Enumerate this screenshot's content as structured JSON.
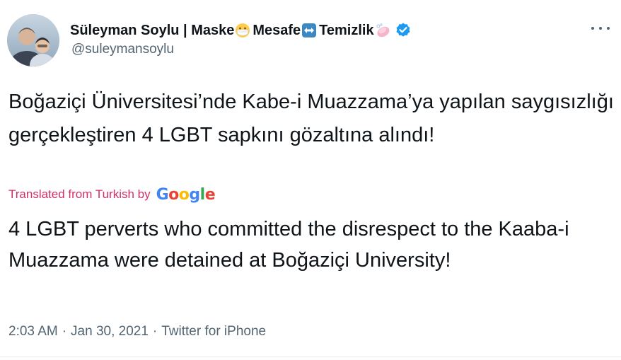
{
  "author": {
    "name_part1": "Süleyman Soylu | Maske",
    "name_part2": "Mesafe",
    "name_part3": "Temizlik",
    "handle": "@suleymansoylu"
  },
  "tweet": {
    "original_text": "Boğaziçi Üniversitesi’nde Kabe-i Muazzama’ya yapılan saygısızlığı gerçekleştiren 4 LGBT sapkını gözaltına alındı!",
    "translated_label": "Translated from Turkish by",
    "google_logo": "Google",
    "translated_text": "4 LGBT perverts who committed the disrespect to the Kaaba-i Muazzama were detained at Boğaziçi University!",
    "time": "2:03 AM",
    "separator": "·",
    "date": "Jan 30, 2021",
    "source": "Twitter for iPhone"
  },
  "icons": {
    "emoji_1": "face-with-medical-mask-icon",
    "emoji_2": "left-right-arrow-icon",
    "emoji_3": "soap-icon",
    "verified": "verified-badge-icon",
    "more": "more-options-icon"
  },
  "colors": {
    "text": "#0f1419",
    "secondary": "#536471",
    "translated": "#d32f6a",
    "verified": "#1d9bf0",
    "google_blue": "#4285f4",
    "google_red": "#ea4335",
    "google_yellow": "#fbbc05",
    "google_green": "#34a853"
  }
}
